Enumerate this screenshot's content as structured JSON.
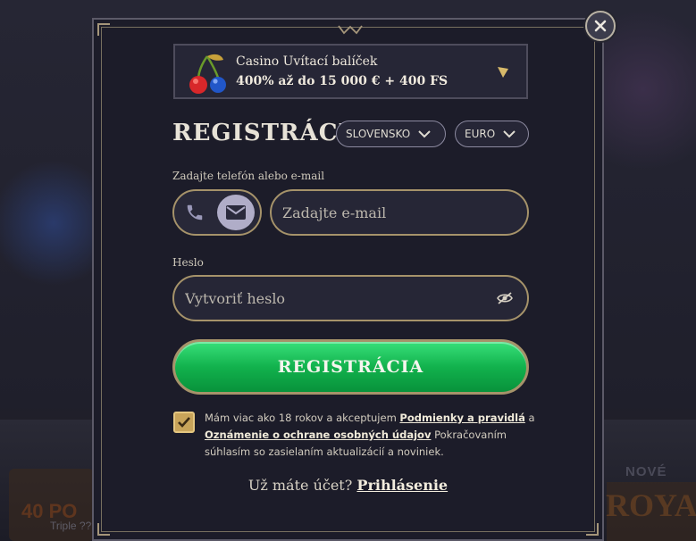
{
  "colors": {
    "accent_gold": "#a6936a",
    "submit_green": "#12b24d",
    "modal_bg": "#1c1c29"
  },
  "background": {
    "left_promo_text": "40 PO",
    "left_promo_sub": "Triple ??????",
    "new_badge": "NOVÉ",
    "right_logo_text": "ROYA"
  },
  "close": {
    "icon": "close-icon"
  },
  "bonus": {
    "title": "Casino Uvítací balíček",
    "subtitle": "400% až do 15 000 € + 400 FS",
    "icon": "cherry-icon",
    "expand_icon": "chevron-down-icon"
  },
  "registration": {
    "title": "REGISTRÁCIA",
    "country": "SLOVENSKO",
    "currency": "EURO"
  },
  "contact": {
    "label": "Zadajte telefón alebo e-mail",
    "email_placeholder": "Zadajte e-mail",
    "selected_method": "email"
  },
  "password": {
    "label": "Heslo",
    "placeholder": "Vytvoriť heslo"
  },
  "submit_label": "REGISTRÁCIA",
  "terms": {
    "checked": true,
    "prefix": "Mám viac ako 18 rokov a akceptujem ",
    "link_terms": "Podmienky a pravidlá",
    "middle": " a ",
    "link_privacy": "Oznámenie o ochrane osobných údajov",
    "suffix": " Pokračovaním súhlasím so zasielaním aktualizácií a noviniek."
  },
  "login": {
    "prompt": "Už máte účet?",
    "link": "Prihlásenie"
  }
}
